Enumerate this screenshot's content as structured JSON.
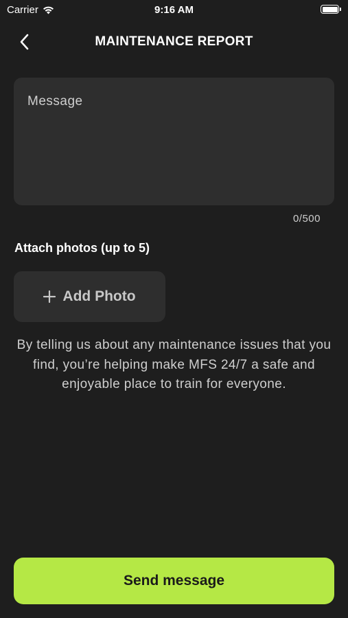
{
  "status_bar": {
    "carrier": "Carrier",
    "time": "9:16 AM"
  },
  "nav": {
    "title": "MAINTENANCE REPORT"
  },
  "message": {
    "placeholder": "Message",
    "value": "",
    "counter": "0/500"
  },
  "attach": {
    "label": "Attach photos (up to 5)",
    "button_label": "Add Photo"
  },
  "info_text": "By telling us about any maintenance issues that you find, you’re helping make MFS 24/7 a safe and enjoyable place to train for everyone.",
  "send_button": {
    "label": "Send message"
  },
  "colors": {
    "background": "#1e1e1e",
    "card": "#2e2e2e",
    "accent": "#b5e845"
  }
}
